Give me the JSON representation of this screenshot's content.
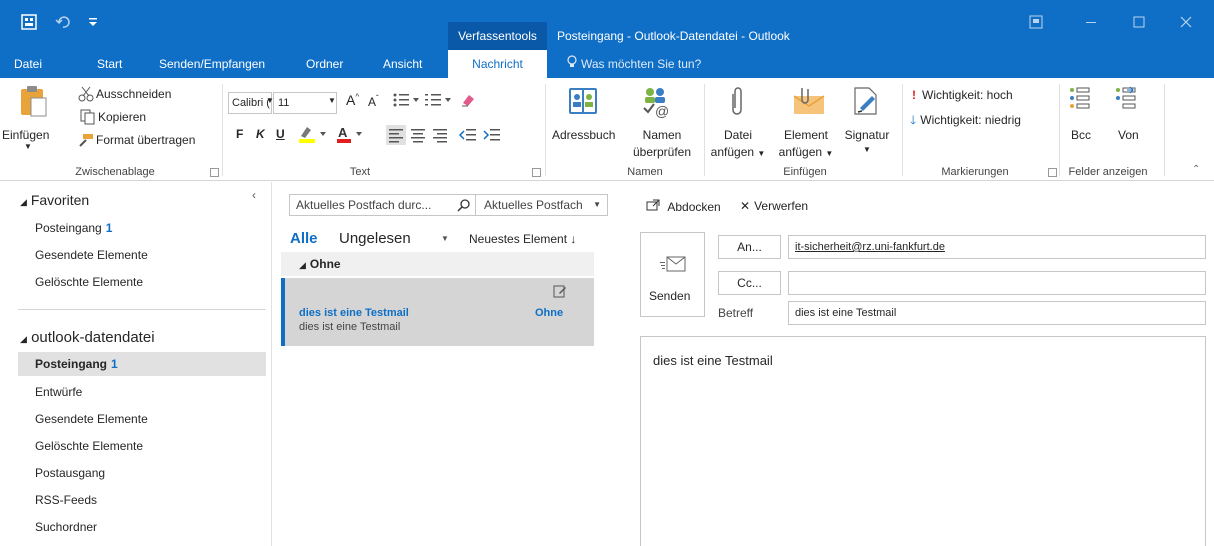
{
  "colors": {
    "accent": "#0f6fc6",
    "dark_accent": "#0a58a8",
    "selection": "#d5d5d5"
  },
  "titlebar": {
    "context_tab": "Verfassentools",
    "title": "Posteingang - Outlook-Datendatei - Outlook",
    "icons": [
      "outlook-app-icon",
      "undo-icon",
      "qat-customize-icon",
      "ribbon-display-icon",
      "minimize-icon",
      "maximize-icon",
      "close-icon"
    ]
  },
  "tabs": {
    "file": "Datei",
    "start": "Start",
    "send_receive": "Senden/Empfangen",
    "folder": "Ordner",
    "view": "Ansicht",
    "message": "Nachricht",
    "tell_me": "Was möchten Sie tun?"
  },
  "ribbon": {
    "clipboard": {
      "paste": "Einfügen",
      "cut": "Ausschneiden",
      "copy": "Kopieren",
      "format_painter": "Format übertragen",
      "label": "Zwischenablage"
    },
    "text": {
      "font": "Calibri (T",
      "size": "11",
      "bold": "F",
      "italic": "K",
      "underline": "U",
      "label": "Text"
    },
    "names": {
      "address_book": "Adressbuch",
      "check_names_1": "Namen",
      "check_names_2": "überprüfen",
      "label": "Namen"
    },
    "include": {
      "attach_file_1": "Datei",
      "attach_file_2": "anfügen",
      "attach_item_1": "Element",
      "attach_item_2": "anfügen",
      "signature": "Signatur",
      "label": "Einfügen"
    },
    "tags": {
      "high": "Wichtigkeit: hoch",
      "low": "Wichtigkeit: niedrig",
      "label": "Markierungen"
    },
    "fields": {
      "bcc": "Bcc",
      "from": "Von",
      "label": "Felder anzeigen"
    }
  },
  "nav": {
    "favorites_header": "Favoriten",
    "favorites": [
      {
        "label": "Posteingang",
        "count": "1"
      },
      {
        "label": "Gesendete Elemente",
        "count": ""
      },
      {
        "label": "Gelöschte Elemente",
        "count": ""
      }
    ],
    "datafile_header": "outlook-datendatei",
    "folders": [
      {
        "label": "Posteingang",
        "count": "1"
      },
      {
        "label": "Entwürfe",
        "count": ""
      },
      {
        "label": "Gesendete Elemente",
        "count": ""
      },
      {
        "label": "Gelöschte Elemente",
        "count": ""
      },
      {
        "label": "Postausgang",
        "count": ""
      },
      {
        "label": "RSS-Feeds",
        "count": ""
      },
      {
        "label": "Suchordner",
        "count": ""
      }
    ]
  },
  "list": {
    "search_placeholder": "Aktuelles Postfach durc...",
    "scope": "Aktuelles Postfach",
    "filter_all": "Alle",
    "filter_unread": "Ungelesen",
    "sort": "Neuestes Element",
    "group": "Ohne",
    "items": [
      {
        "subject": "dies ist eine Testmail",
        "preview": "dies ist eine Testmail",
        "category": "Ohne"
      }
    ]
  },
  "compose": {
    "popout": "Abdocken",
    "discard": "Verwerfen",
    "send": "Senden",
    "to_button": "An...",
    "cc_button": "Cc...",
    "to_value": "it-sicherheit@rz.uni-fankfurt.de",
    "cc_value": "",
    "subject_label": "Betreff",
    "subject_value": "dies ist eine Testmail",
    "body": "dies ist eine Testmail"
  }
}
